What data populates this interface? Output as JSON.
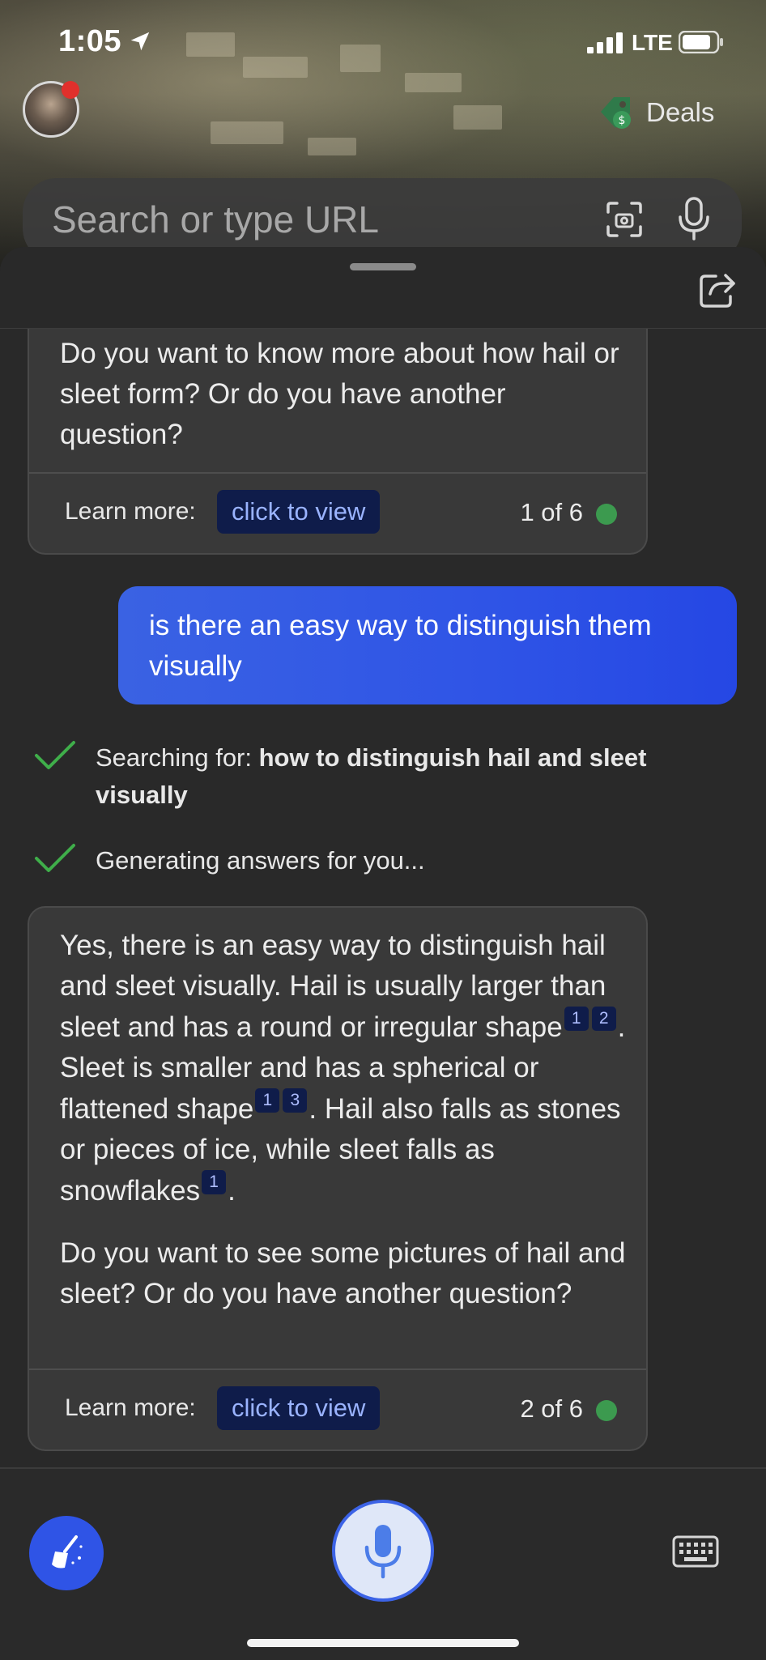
{
  "status_bar": {
    "time": "1:05",
    "network": "LTE"
  },
  "header": {
    "deals_label": "Deals"
  },
  "search": {
    "placeholder": "Search or type URL"
  },
  "chat": {
    "card1": {
      "text": "Do you want to know more about how hail or sleet form? Or do you have another question?",
      "learn_more_label": "Learn more:",
      "learn_more_button": "click to view",
      "page_count": "1 of 6"
    },
    "user_message": "is there an easy way to distinguish them visually",
    "steps": [
      {
        "prefix": "Searching for: ",
        "query": "how to distinguish hail and sleet visually"
      },
      {
        "text": "Generating answers for you..."
      }
    ],
    "card2": {
      "para1": {
        "s1": "Yes, there is an easy way to distinguish hail and sleet visually. Hail is usually larger than sleet and has a round or irregular shape",
        "c1": "1",
        "c2": "2",
        "s2": ". Sleet is smaller and has a spherical or flattened shape",
        "c3": "1",
        "c4": "3",
        "s3": ". Hail also falls as stones or pieces of ice, while sleet falls as snowflakes",
        "c5": "1",
        "s4": "."
      },
      "para2": "Do you want to see some pictures of hail and sleet? Or do you have another question?",
      "learn_more_label": "Learn more:",
      "learn_more_button": "click to view",
      "page_count": "2 of 6"
    }
  },
  "colors": {
    "accent": "#2f54e6",
    "citation_bg": "#0f1c4a",
    "status_dot": "#3c9a4f",
    "check": "#3fae4a"
  },
  "icons": [
    "location-arrow-icon",
    "signal-icon",
    "battery-icon",
    "deals-tag-icon",
    "scan-icon",
    "microphone-icon",
    "share-icon",
    "checkmark-icon",
    "broom-icon",
    "keyboard-icon"
  ]
}
